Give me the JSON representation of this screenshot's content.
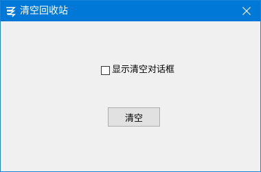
{
  "window": {
    "title": "清空回收站",
    "titlebar_color": "#0078d7",
    "app_icon": "recycle-app-icon",
    "close_icon": "close-icon"
  },
  "options": {
    "show_dialog_label": "显示清空对话框",
    "show_dialog_checked": false
  },
  "actions": {
    "empty_label": "清空"
  }
}
